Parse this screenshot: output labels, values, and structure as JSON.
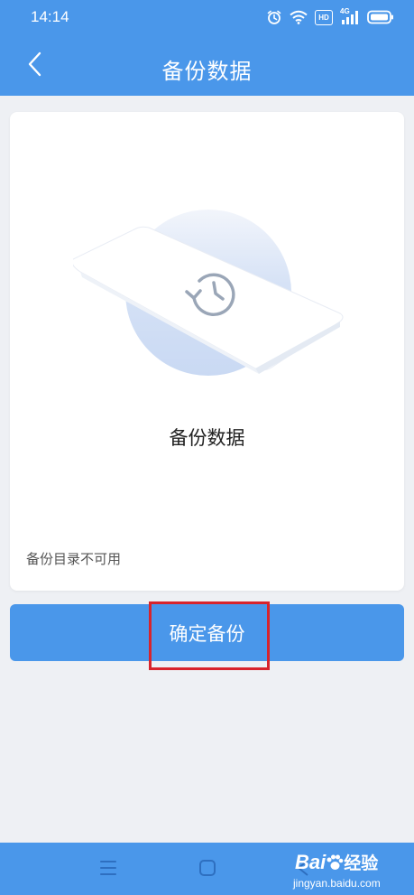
{
  "status_bar": {
    "time": "14:14",
    "icons": [
      "alarm-icon",
      "wifi-icon",
      "hd-icon",
      "signal-4g-icon",
      "battery-icon"
    ],
    "hd_label": "HD",
    "network_label": "4G"
  },
  "app_bar": {
    "title": "备份数据",
    "back_icon": "chevron-left-icon"
  },
  "card": {
    "title": "备份数据",
    "note": "备份目录不可用",
    "illustration_icon": "restore-clock-icon"
  },
  "actions": {
    "confirm_label": "确定备份"
  },
  "nav_bar": {
    "icons": [
      "menu-icon",
      "home-square-icon",
      "back-triangle-icon"
    ]
  },
  "watermark": {
    "brand": "Bai",
    "brand_suffix": "经验",
    "url": "jingyan.baidu.com"
  },
  "colors": {
    "primary": "#4a97ea",
    "background": "#eef0f4",
    "highlight": "#d8242c"
  }
}
